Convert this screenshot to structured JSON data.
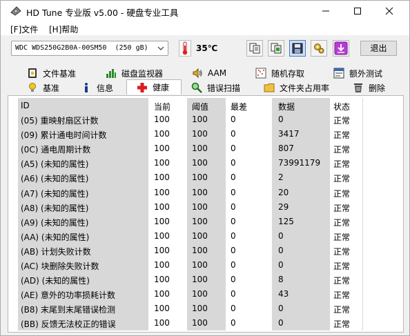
{
  "window": {
    "title": "HD Tune 专业版 v5.00 - 硬盘专业工具"
  },
  "menu": [
    {
      "label": "[F]文件"
    },
    {
      "label": "[H]帮助"
    }
  ],
  "toolbar": {
    "drive": "WDC WDS250G2B0A-00SM50  (250 gB)",
    "temperature": "35℃",
    "exit_label": "退出"
  },
  "tabs_top": [
    {
      "label": "文件基准",
      "icon": "file-benchmark-icon"
    },
    {
      "label": "磁盘监视器",
      "icon": "disk-monitor-icon"
    },
    {
      "label": "AAM",
      "icon": "speaker-icon"
    },
    {
      "label": "随机存取",
      "icon": "random-access-icon"
    },
    {
      "label": "额外测试",
      "icon": "extra-tests-icon"
    }
  ],
  "tabs_bottom": [
    {
      "label": "基准",
      "icon": "benchmark-icon"
    },
    {
      "label": "信息",
      "icon": "info-icon"
    },
    {
      "label": "健康",
      "icon": "health-cross-icon",
      "selected": true
    },
    {
      "label": "错误扫描",
      "icon": "error-scan-icon"
    },
    {
      "label": "文件夹占用率",
      "icon": "folder-usage-icon"
    },
    {
      "label": "删除",
      "icon": "erase-icon"
    }
  ],
  "smart_table": {
    "headers": [
      "ID",
      "当前",
      "阈值",
      "最差",
      "数据",
      "状态"
    ],
    "rows": [
      [
        "(05) 重映射扇区计数",
        "100",
        "100",
        "0",
        "0",
        "正常"
      ],
      [
        "(09) 累计通电时间计数",
        "100",
        "100",
        "0",
        "3417",
        "正常"
      ],
      [
        "(0C) 通电周期计数",
        "100",
        "100",
        "0",
        "807",
        "正常"
      ],
      [
        "(A5) (未知的属性)",
        "100",
        "100",
        "0",
        "73991179",
        "正常"
      ],
      [
        "(A6) (未知的属性)",
        "100",
        "100",
        "0",
        "2",
        "正常"
      ],
      [
        "(A7) (未知的属性)",
        "100",
        "100",
        "0",
        "20",
        "正常"
      ],
      [
        "(A8) (未知的属性)",
        "100",
        "100",
        "0",
        "29",
        "正常"
      ],
      [
        "(A9) (未知的属性)",
        "100",
        "100",
        "0",
        "125",
        "正常"
      ],
      [
        "(AA) (未知的属性)",
        "100",
        "100",
        "0",
        "0",
        "正常"
      ],
      [
        "(AB) 计划失败计数",
        "100",
        "100",
        "0",
        "0",
        "正常"
      ],
      [
        "(AC) 块删除失败计数",
        "100",
        "100",
        "0",
        "0",
        "正常"
      ],
      [
        "(AD) (未知的属性)",
        "100",
        "100",
        "0",
        "8",
        "正常"
      ],
      [
        "(AE) 意外的功率损耗计数",
        "100",
        "100",
        "0",
        "43",
        "正常"
      ],
      [
        "(B8) 末尾到末尾错误检测",
        "100",
        "100",
        "0",
        "0",
        "正常"
      ],
      [
        "(BB) 反馈无法校正的错误",
        "100",
        "100",
        "0",
        "0",
        "正常"
      ]
    ]
  }
}
